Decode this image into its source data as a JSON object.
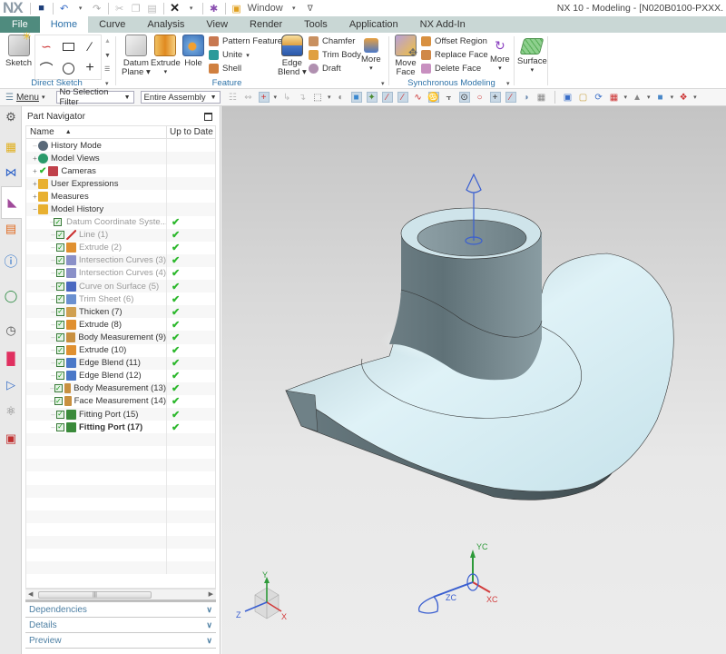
{
  "app": {
    "logo": "NX",
    "window_menu": "Window",
    "title": "NX 10 - Modeling - [N020B0100-PXXX."
  },
  "ribbon_tabs": [
    {
      "label": "File",
      "state": "file"
    },
    {
      "label": "Home",
      "state": "active"
    },
    {
      "label": "Curve",
      "state": ""
    },
    {
      "label": "Analysis",
      "state": ""
    },
    {
      "label": "View",
      "state": ""
    },
    {
      "label": "Render",
      "state": ""
    },
    {
      "label": "Tools",
      "state": ""
    },
    {
      "label": "Application",
      "state": ""
    },
    {
      "label": "NX Add-In",
      "state": ""
    }
  ],
  "ribbon": {
    "direct_sketch": {
      "label": "Direct Sketch",
      "sketch": "Sketch"
    },
    "feature": {
      "label": "Feature",
      "datum_plane": "Datum",
      "datum_plane_2": "Plane",
      "extrude": "Extrude",
      "hole": "Hole",
      "pattern_feature": "Pattern Feature",
      "unite": "Unite",
      "shell": "Shell",
      "edge_blend": "Edge",
      "edge_blend_2": "Blend",
      "chamfer": "Chamfer",
      "trim_body": "Trim Body",
      "draft": "Draft",
      "more": "More"
    },
    "synchronous": {
      "label": "Synchronous Modeling",
      "move_face": "Move",
      "move_face_2": "Face",
      "offset_region": "Offset Region",
      "replace_face": "Replace Face",
      "delete_face": "Delete Face",
      "more": "More"
    },
    "surface": {
      "label": "Surface"
    }
  },
  "toolbar": {
    "menu": "Menu",
    "selection_filter": "No Selection Filter",
    "assembly_scope": "Entire Assembly"
  },
  "navigator": {
    "title": "Part Navigator",
    "col_name": "Name",
    "col_uptodate": "Up to Date",
    "rows": [
      {
        "label": "History Mode",
        "level": 0,
        "expander": "",
        "check": false,
        "icon": "clock",
        "uptodate": false,
        "style": ""
      },
      {
        "label": "Model Views",
        "level": 0,
        "expander": "+",
        "check": false,
        "icon": "views",
        "uptodate": false,
        "style": ""
      },
      {
        "label": "Cameras",
        "level": 0,
        "expander": "+",
        "check": "tick",
        "icon": "camera",
        "uptodate": false,
        "style": ""
      },
      {
        "label": "User Expressions",
        "level": 0,
        "expander": "+",
        "check": false,
        "icon": "folder",
        "uptodate": false,
        "style": ""
      },
      {
        "label": "Measures",
        "level": 0,
        "expander": "+",
        "check": false,
        "icon": "folder",
        "uptodate": false,
        "style": ""
      },
      {
        "label": "Model History",
        "level": 0,
        "expander": "−",
        "check": false,
        "icon": "folder-open",
        "uptodate": false,
        "style": ""
      },
      {
        "label": "Datum Coordinate Syste...",
        "level": 1,
        "expander": "",
        "check": true,
        "icon": "datum",
        "uptodate": true,
        "style": "dim"
      },
      {
        "label": "Line (1)",
        "level": 1,
        "expander": "",
        "check": true,
        "icon": "line",
        "uptodate": true,
        "style": "dim"
      },
      {
        "label": "Extrude (2)",
        "level": 1,
        "expander": "",
        "check": true,
        "icon": "extrude",
        "uptodate": true,
        "style": "dim"
      },
      {
        "label": "Intersection Curves (3)",
        "level": 1,
        "expander": "",
        "check": true,
        "icon": "intersect",
        "uptodate": true,
        "style": "dim"
      },
      {
        "label": "Intersection Curves (4)",
        "level": 1,
        "expander": "",
        "check": true,
        "icon": "intersect",
        "uptodate": true,
        "style": "dim"
      },
      {
        "label": "Curve on Surface (5)",
        "level": 1,
        "expander": "",
        "check": true,
        "icon": "curve-surface",
        "uptodate": true,
        "style": "dim"
      },
      {
        "label": "Trim Sheet (6)",
        "level": 1,
        "expander": "",
        "check": true,
        "icon": "trim",
        "uptodate": true,
        "style": "dim"
      },
      {
        "label": "Thicken (7)",
        "level": 1,
        "expander": "",
        "check": true,
        "icon": "thicken",
        "uptodate": true,
        "style": ""
      },
      {
        "label": "Extrude (8)",
        "level": 1,
        "expander": "",
        "check": true,
        "icon": "extrude",
        "uptodate": true,
        "style": ""
      },
      {
        "label": "Body Measurement (9)",
        "level": 1,
        "expander": "",
        "check": true,
        "icon": "measure",
        "uptodate": true,
        "style": ""
      },
      {
        "label": "Extrude (10)",
        "level": 1,
        "expander": "",
        "check": true,
        "icon": "extrude",
        "uptodate": true,
        "style": ""
      },
      {
        "label": "Edge Blend (11)",
        "level": 1,
        "expander": "",
        "check": true,
        "icon": "blend",
        "uptodate": true,
        "style": ""
      },
      {
        "label": "Edge Blend (12)",
        "level": 1,
        "expander": "",
        "check": true,
        "icon": "blend",
        "uptodate": true,
        "style": ""
      },
      {
        "label": "Body Measurement (13)",
        "level": 1,
        "expander": "",
        "check": true,
        "icon": "measure",
        "uptodate": true,
        "style": ""
      },
      {
        "label": "Face Measurement (14)",
        "level": 1,
        "expander": "",
        "check": true,
        "icon": "measure",
        "uptodate": true,
        "style": ""
      },
      {
        "label": "Fitting Port (15)",
        "level": 1,
        "expander": "",
        "check": true,
        "icon": "port",
        "uptodate": true,
        "style": ""
      },
      {
        "label": "Fitting Port (17)",
        "level": 1,
        "expander": "",
        "check": true,
        "icon": "port",
        "uptodate": true,
        "style": "bold"
      }
    ],
    "panels": [
      "Dependencies",
      "Details",
      "Preview"
    ]
  },
  "viewport": {
    "view_triad": {
      "x": "X",
      "y": "Y",
      "z": "Z"
    },
    "wcs": {
      "x": "XC",
      "y": "YC",
      "z": "ZC"
    }
  },
  "colors": {
    "file_tab": "#4f8b7e",
    "active_tab_text": "#2a6fa8",
    "group_label": "#2f73a8",
    "uptodate_tick": "#2db82d",
    "axis_x": "#d23c3c",
    "axis_y": "#2e9a3a",
    "axis_z": "#3a5fd0"
  }
}
